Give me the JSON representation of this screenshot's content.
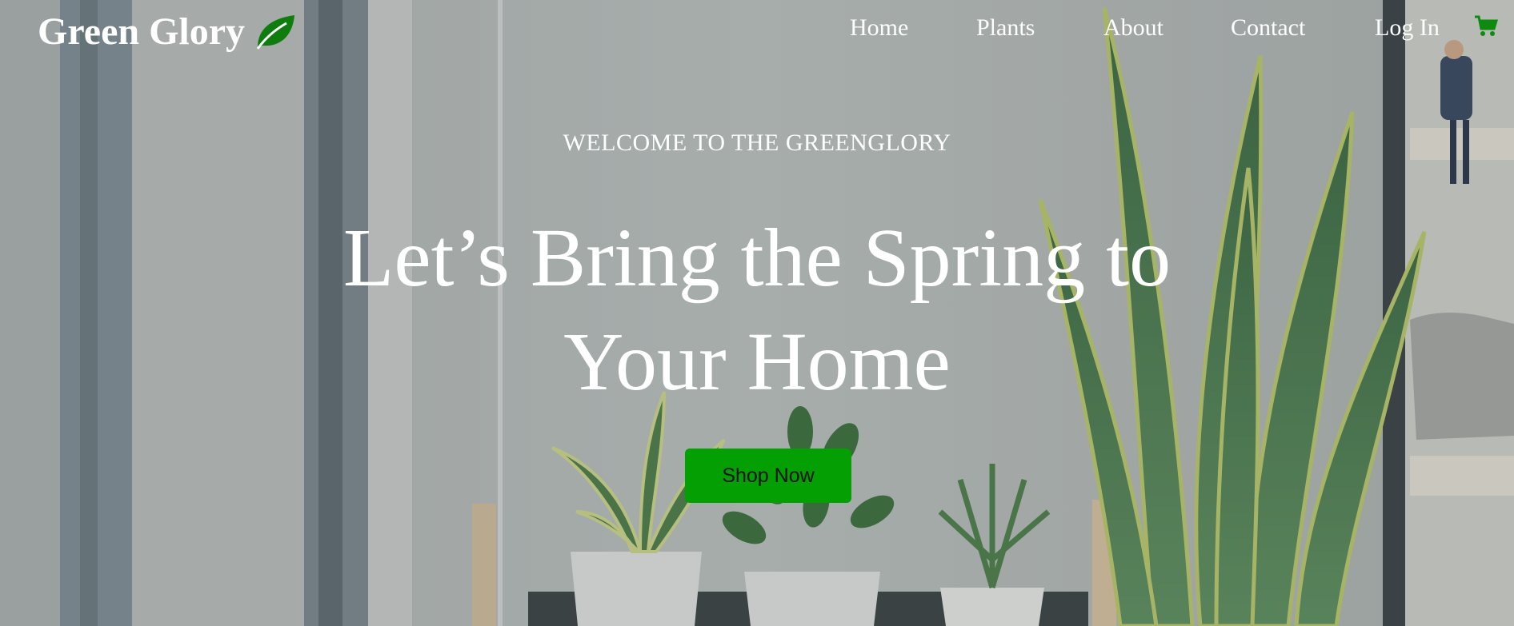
{
  "brand": {
    "name": "Green Glory",
    "icon": "leaf-icon",
    "color": "#ffffff",
    "icon_color": "#0e7d0e"
  },
  "nav": {
    "items": [
      {
        "label": "Home"
      },
      {
        "label": "Plants"
      },
      {
        "label": "About"
      },
      {
        "label": "Contact"
      },
      {
        "label": "Log In"
      }
    ],
    "cart_icon": "cart-icon",
    "cart_color": "#0e8a0e"
  },
  "hero": {
    "eyebrow": "WELCOME TO THE GREENGLORY",
    "headline_line1": "Let’s Bring the Spring to",
    "headline_line2": "Your Home",
    "cta_label": "Shop Now",
    "cta_color": "#039f03"
  }
}
